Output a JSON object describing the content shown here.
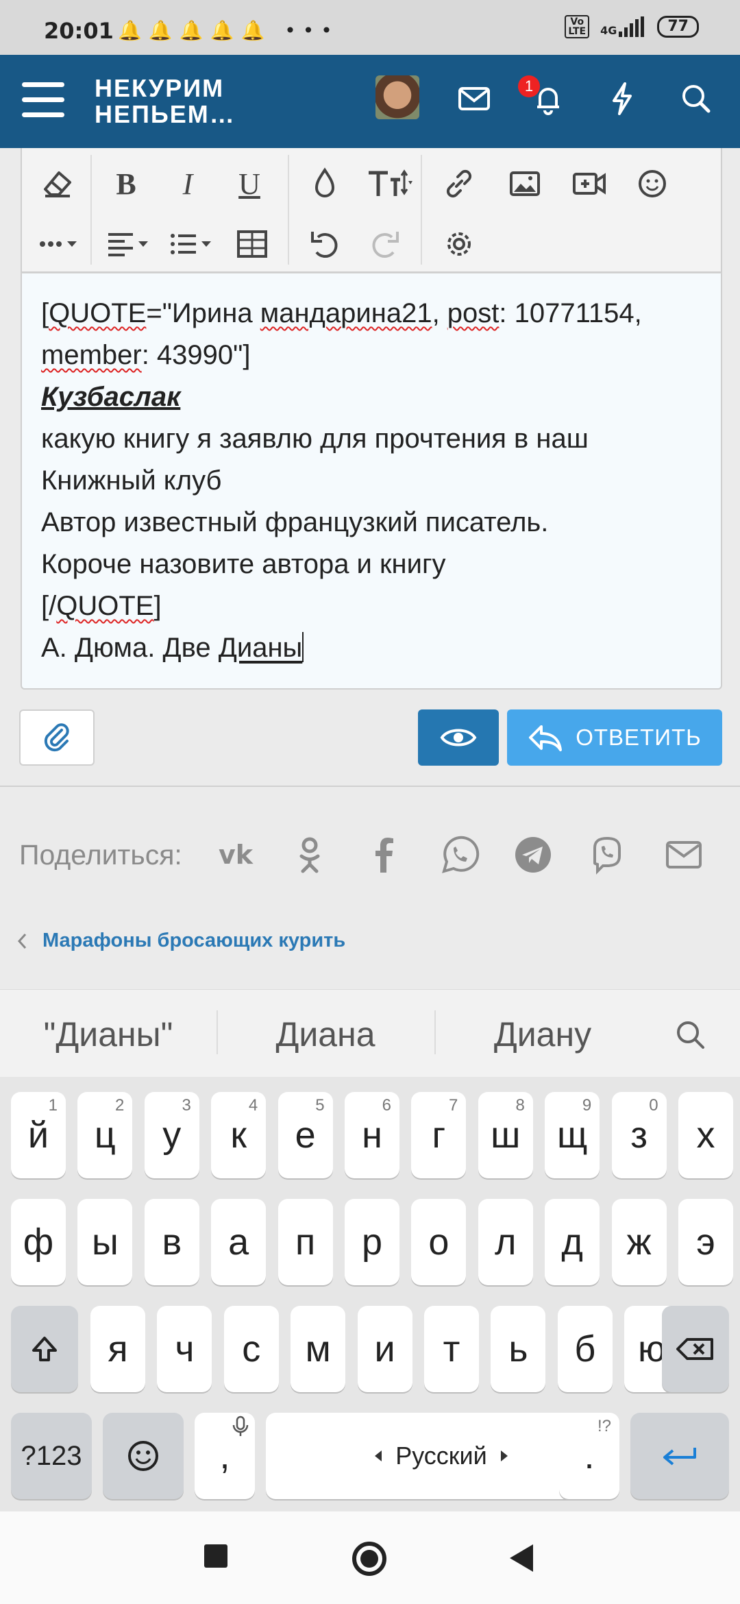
{
  "status_bar": {
    "time": "20:01",
    "notification_icons": "🔔🔔🔔🔔🔔 •••",
    "network": "4G",
    "lte_label": "Vo\nLTE",
    "battery": "77"
  },
  "header": {
    "logo_line1": "НЕКУРИМ",
    "logo_line2": "НЕПЬЕМ…",
    "notification_count": "1",
    "bg_color": "#185886"
  },
  "editor": {
    "lines": [
      "[QUOTE=\"Ирина мандарина21, post: 10771154, member: 43990\"]",
      "Кузбаслак",
      "какую книгу я заявлю для прочтения в наш Книжный клуб",
      "Автор известный французкий писатель.",
      "Короче назовите автора и книгу",
      "[/QUOTE]",
      "А. Дюма. Две Дианы"
    ],
    "quote_open_a": "[",
    "quote_open_b": "QUOTE",
    "quote_open_c": "=\"Ирина ",
    "quote_open_d": "мандарина21",
    "quote_open_e": ", ",
    "quote_open_f": "post",
    "quote_open_g": ": 10771154, ",
    "quote_open_h": "member",
    "quote_open_i": ": 43990\"]",
    "quoted_user": "Кузбаслак",
    "quote_text_1": "какую книгу я заявлю для прочтения в наш Книжный клуб",
    "quote_text_2": "Автор известный французкий писатель.",
    "quote_text_3": "Короче назовите автора и книгу",
    "quote_close_a": "[/",
    "quote_close_b": "QUOTE",
    "quote_close_c": "]",
    "answer_a": "А. Дюма. Две ",
    "answer_b": "Дианы"
  },
  "actions": {
    "reply_label": "ОТВЕТИТЬ",
    "accent": "#47a7eb",
    "preview_color": "#2577b1"
  },
  "share": {
    "label": "Поделиться:",
    "networks": [
      "vk-icon",
      "odnoklassniki-icon",
      "facebook-icon",
      "whatsapp-icon",
      "telegram-icon",
      "viber-icon",
      "mail-icon"
    ]
  },
  "breadcrumb": {
    "label": "Марафоны бросающих курить"
  },
  "keyboard": {
    "suggestions": [
      "\"Дианы\"",
      "Диана",
      "Диану"
    ],
    "row1": [
      {
        "k": "й",
        "h": "1"
      },
      {
        "k": "ц",
        "h": "2"
      },
      {
        "k": "у",
        "h": "3"
      },
      {
        "k": "к",
        "h": "4"
      },
      {
        "k": "е",
        "h": "5"
      },
      {
        "k": "н",
        "h": "6"
      },
      {
        "k": "г",
        "h": "7"
      },
      {
        "k": "ш",
        "h": "8"
      },
      {
        "k": "щ",
        "h": "9"
      },
      {
        "k": "з",
        "h": "0"
      },
      {
        "k": "х",
        "h": ""
      }
    ],
    "row2": [
      "ф",
      "ы",
      "в",
      "а",
      "п",
      "р",
      "о",
      "л",
      "д",
      "ж",
      "э"
    ],
    "row3": [
      "я",
      "ч",
      "с",
      "м",
      "и",
      "т",
      "ь",
      "б",
      "ю"
    ],
    "symbols_label": "?123",
    "comma": ",",
    "space_label": "Русский",
    "period": ".",
    "period_hint": "!?"
  }
}
